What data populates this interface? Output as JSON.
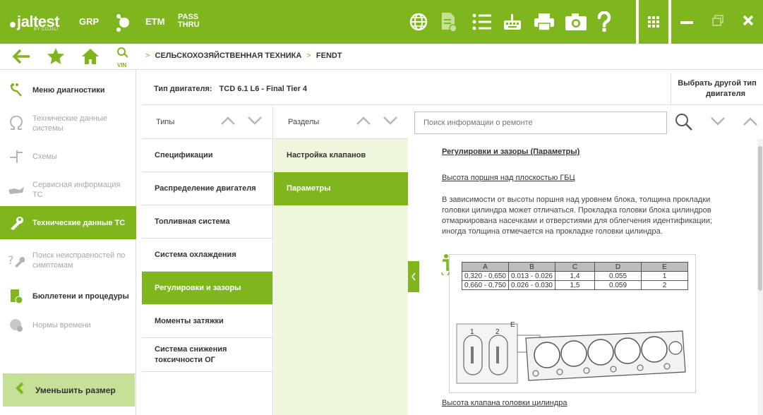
{
  "header": {
    "logo": "jaltest",
    "logo_sub": "BY COJALI",
    "grp": "GRP",
    "etm": "ETM",
    "pass": "PASS",
    "thru": "THRU",
    "accent": "#7fb61e"
  },
  "breadcrumb": {
    "sep": ">",
    "level1": "СЕЛЬСКОХОЗЯЙСТВЕННАЯ ТЕХНИКА",
    "level2": "FENDT"
  },
  "nav": {
    "vin_label": "VIN"
  },
  "sidebar": {
    "items": [
      {
        "label": "Меню диагностики",
        "icon": "diagnostics-icon"
      },
      {
        "label": "Технические данные системы",
        "icon": "omega-icon"
      },
      {
        "label": "Схемы",
        "icon": "schematic-icon"
      },
      {
        "label": "Сервисная информация ТС",
        "icon": "oil-can-icon"
      },
      {
        "label": "Технические данные ТС",
        "icon": "wrench-icon"
      },
      {
        "label": "Поиск неисправностей по симптомам",
        "icon": "symptom-search-icon"
      },
      {
        "label": "Бюллетени и процедуры",
        "icon": "bulletins-icon"
      },
      {
        "label": "Нормы времени",
        "icon": "time-icon"
      }
    ],
    "shrink_label": "Уменьшить размер"
  },
  "engine": {
    "label": "Тип двигателя:",
    "value": "TCD 6.1 L6 - Final Tier 4",
    "change_line1": "Выбрать другой тип",
    "change_line2": "двигателя"
  },
  "types": {
    "header": "Типы",
    "items": [
      "Спецификации",
      "Распределение двигателя",
      "Топливная система",
      "Система охлаждения",
      "Регулировки и зазоры",
      "Моменты затяжки",
      "Система снижения токсичности ОГ"
    ],
    "selected_index": 4
  },
  "sections": {
    "header": "Разделы",
    "items": [
      "Настройка клапанов",
      "Параметры"
    ],
    "selected_index": 1
  },
  "search": {
    "placeholder": "Поиск информации о ремонте"
  },
  "content": {
    "title": "Регулировки и зазоры (Параметры)",
    "subtitle": "Высота поршня над плоскостью ГБЦ",
    "paragraph": "В зависимости от высоты поршня над уровнем блока, толщина прокладки головки цилиндра может отличаться. Прокладка головки блока цилиндров отмаркирована насечками и отверстиями для облегчения идентификации; иногда толщина отмечается на прокладке головки цилиндра.",
    "next_link": "Высота клапана головки цилиндра",
    "table": {
      "headers": [
        "A",
        "B",
        "C",
        "D",
        "E"
      ],
      "rows": [
        [
          "0,320 - 0,650",
          "0.013 - 0.026",
          "1,4",
          "0.055",
          "1"
        ],
        [
          "0,660 - 0,750",
          "0.026 - 0.030",
          "1,5",
          "0.059",
          "2"
        ]
      ]
    },
    "figure_labels": {
      "one": "1",
      "two": "2",
      "e": "E"
    }
  }
}
